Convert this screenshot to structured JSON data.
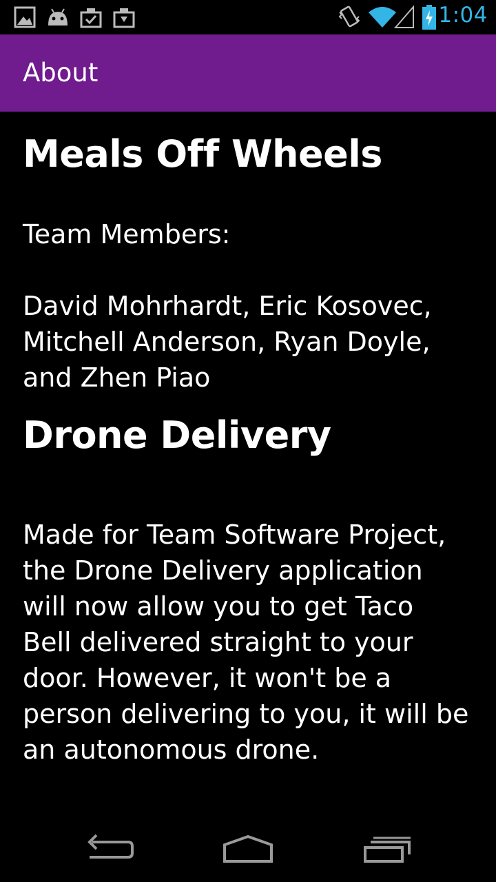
{
  "status_bar": {
    "time": "1:04",
    "accent_color": "#33b5e5",
    "left_icons": [
      "gallery-icon",
      "android-icon",
      "download-done-icon",
      "download-icon"
    ],
    "right_icons": [
      "vibrate-icon",
      "wifi-icon",
      "signal-icon",
      "battery-charging-icon"
    ]
  },
  "action_bar": {
    "title": "About",
    "color": "#701b8e"
  },
  "content": {
    "app_title": "Meals Off Wheels",
    "team_label": "Team Members:",
    "team_members": "David Mohrhardt, Eric Kosovec,\nMitchell Anderson, Ryan Doyle,\nand Zhen Piao",
    "section_title": "Drone Delivery",
    "description": "Made for Team Software Project,\nthe Drone Delivery application\nwill now allow you to get Taco\nBell delivered straight to your\ndoor.  However, it won't be a\nperson delivering to you, it will be\nan autonomous drone."
  },
  "nav_bar": {
    "buttons": [
      "back-icon",
      "home-icon",
      "recents-icon"
    ]
  }
}
